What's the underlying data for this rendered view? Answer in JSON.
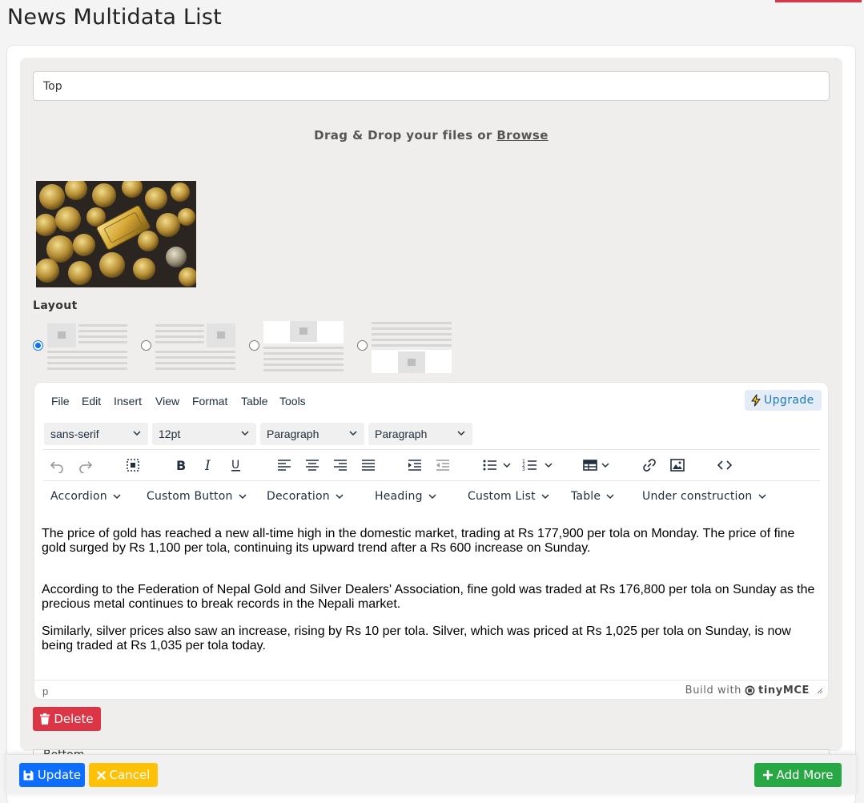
{
  "page": {
    "title": "News Multidata List"
  },
  "section": {
    "title_value": "Top",
    "dropzone_text": "Drag & Drop your files or",
    "dropzone_link": "Browse",
    "layout_label": "Layout",
    "layout_options": [
      {
        "id": "image-left",
        "selected": true
      },
      {
        "id": "image-right",
        "selected": false
      },
      {
        "id": "image-top",
        "selected": false
      },
      {
        "id": "image-bottom",
        "selected": false
      }
    ]
  },
  "editor": {
    "menu": [
      "File",
      "Edit",
      "Insert",
      "View",
      "Format",
      "Table",
      "Tools"
    ],
    "upgrade_label": "Upgrade",
    "selects": {
      "font_family": "sans-serif",
      "font_size": "12pt",
      "block_format": "Paragraph",
      "block_format_2": "Paragraph"
    },
    "custom_toolbar": [
      "Accordion",
      "Custom Button",
      "Decoration",
      "Heading",
      "Custom List",
      "Table",
      "Under construction"
    ],
    "paragraphs": [
      "The price of gold has reached a new all-time high in the domestic market, trading at Rs 177,900 per tola on Monday. The price of fine gold surged by Rs 1,100 per tola, continuing its upward trend after a Rs 600 increase on Sunday.",
      "According to the Federation of Nepal Gold and Silver Dealers' Association, fine gold was traded at Rs 176,800 per tola on Sunday as the precious metal continues to break records in the Nepali market.",
      "Similarly, silver prices also saw an increase, rising by Rs 10 per tola. Silver, which was priced at Rs 1,025 per tola on Sunday, is now being traded at Rs 1,035 per tola today."
    ],
    "status_path": "p",
    "branding_text": "Build with",
    "branding_logo": "tinyMCE"
  },
  "buttons": {
    "delete": "Delete",
    "update": "Update",
    "cancel": "Cancel",
    "add_more": "Add More"
  },
  "next_section": {
    "title_value": "Bottom"
  },
  "colors": {
    "primary": "#0d6efd",
    "danger": "#dc3545",
    "warning": "#ffc107",
    "success": "#28a745",
    "upgrade_bg": "#e3ecf7",
    "upgrade_text": "#207ab7"
  }
}
